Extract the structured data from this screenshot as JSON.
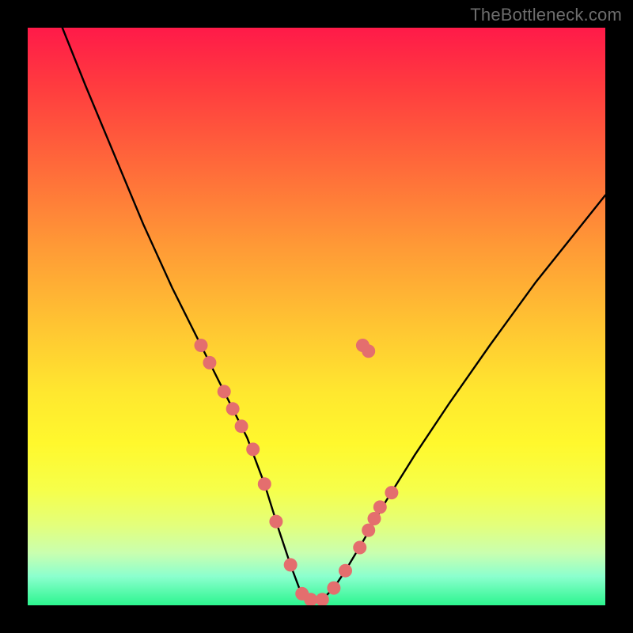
{
  "watermark": "TheBottleneck.com",
  "chart_data": {
    "type": "line",
    "title": "",
    "xlabel": "",
    "ylabel": "",
    "xlim": [
      0,
      100
    ],
    "ylim": [
      0,
      100
    ],
    "series": [
      {
        "name": "curve",
        "x": [
          6,
          10,
          15,
          20,
          25,
          30,
          34,
          38,
          41,
          43.5,
          45.5,
          47,
          49,
          51,
          53,
          55,
          58,
          62,
          67,
          73,
          80,
          88,
          96,
          100
        ],
        "y": [
          100,
          90,
          78,
          66,
          55,
          45,
          37,
          29,
          21,
          13,
          7,
          3,
          1,
          1,
          3,
          6,
          11,
          18,
          26,
          35,
          45,
          56,
          66,
          71
        ]
      }
    ],
    "markers": [
      {
        "series": "curve",
        "x": 30.0,
        "y": 45.0
      },
      {
        "series": "curve",
        "x": 31.5,
        "y": 42.0
      },
      {
        "series": "curve",
        "x": 34.0,
        "y": 37.0
      },
      {
        "series": "curve",
        "x": 35.5,
        "y": 34.0
      },
      {
        "series": "curve",
        "x": 37.0,
        "y": 31.0
      },
      {
        "series": "curve",
        "x": 39.0,
        "y": 27.0
      },
      {
        "series": "curve",
        "x": 41.0,
        "y": 21.0
      },
      {
        "series": "curve",
        "x": 43.0,
        "y": 14.5
      },
      {
        "series": "curve",
        "x": 45.5,
        "y": 7.0
      },
      {
        "series": "curve",
        "x": 47.5,
        "y": 2.0
      },
      {
        "series": "curve",
        "x": 49.0,
        "y": 1.0
      },
      {
        "series": "curve",
        "x": 51.0,
        "y": 1.0
      },
      {
        "series": "curve",
        "x": 53.0,
        "y": 3.0
      },
      {
        "series": "curve",
        "x": 55.0,
        "y": 6.0
      },
      {
        "series": "curve",
        "x": 57.5,
        "y": 10.0
      },
      {
        "series": "curve",
        "x": 59.0,
        "y": 13.0
      },
      {
        "series": "curve",
        "x": 60.0,
        "y": 15.0
      },
      {
        "series": "curve",
        "x": 61.0,
        "y": 17.0
      },
      {
        "series": "curve",
        "x": 63.0,
        "y": 19.5
      },
      {
        "series": "curve",
        "x": 58.0,
        "y": 45.0
      },
      {
        "series": "curve",
        "x": 59.0,
        "y": 44.0
      }
    ],
    "marker_color": "#e46e6e",
    "curve_color": "#000000"
  }
}
